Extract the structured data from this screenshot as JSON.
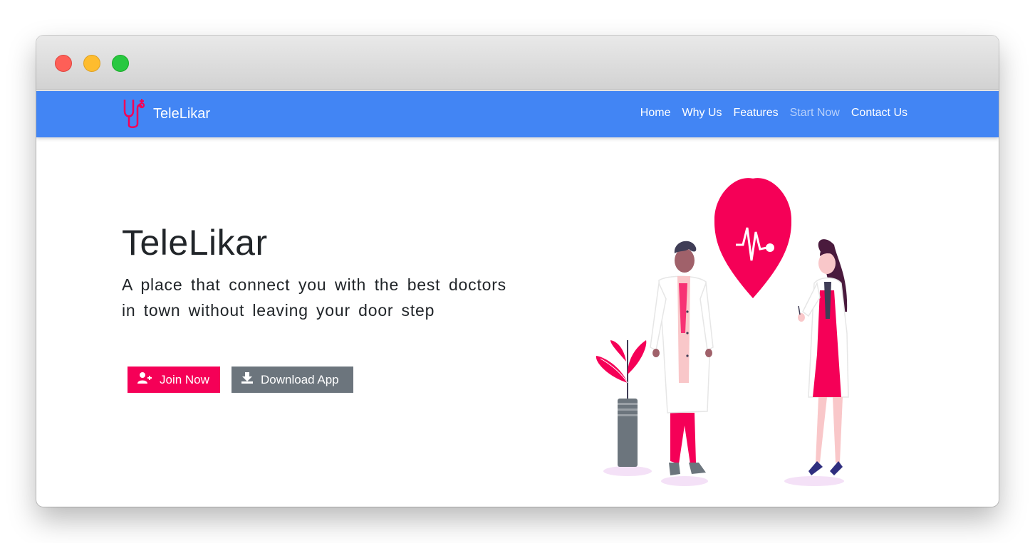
{
  "window": {
    "controls": [
      "close",
      "minimize",
      "zoom"
    ]
  },
  "navbar": {
    "brand": "TeleLikar",
    "links": [
      "Home",
      "Why Us",
      "Features",
      "Start Now",
      "Contact Us"
    ]
  },
  "hero": {
    "title": "TeleLikar",
    "description": "A place that connect you with the best doctors in town without leaving your door step",
    "join_label": "Join Now",
    "download_label": "Download App"
  },
  "icons": {
    "logo": "stethoscope-icon",
    "join": "user-plus-icon",
    "download": "download-icon"
  },
  "colors": {
    "navbar": "#4285f4",
    "accent": "#f50057",
    "secondary": "#6c757d"
  }
}
